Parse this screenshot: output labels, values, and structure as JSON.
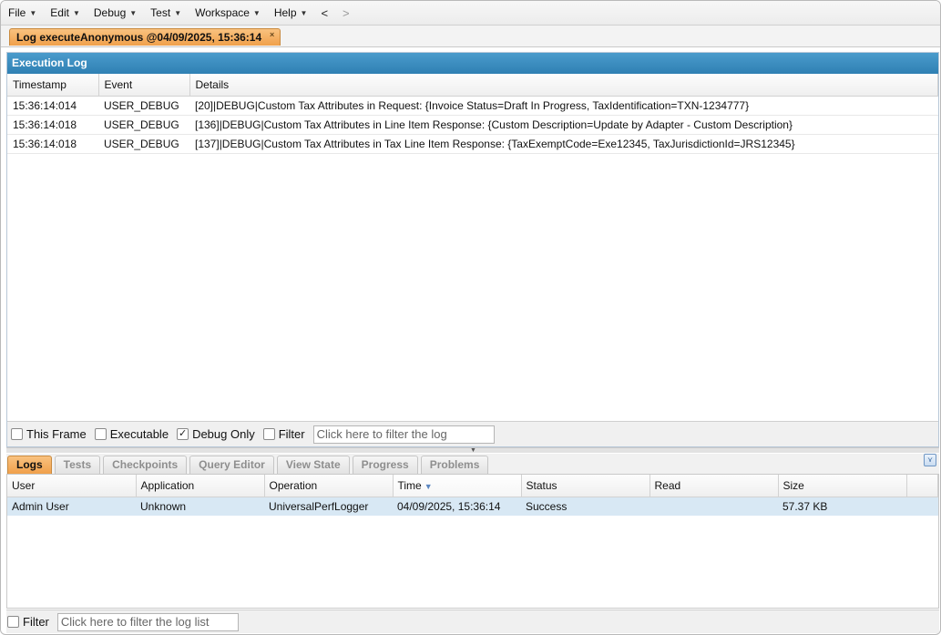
{
  "menubar": {
    "items": [
      {
        "label": "File"
      },
      {
        "label": "Edit"
      },
      {
        "label": "Debug"
      },
      {
        "label": "Test"
      },
      {
        "label": "Workspace"
      },
      {
        "label": "Help"
      }
    ],
    "back": "<",
    "forward": ">"
  },
  "doc_tab": {
    "label": "Log executeAnonymous @04/09/2025, 15:36:14",
    "close": "×"
  },
  "execution_log": {
    "title": "Execution Log",
    "columns": [
      "Timestamp",
      "Event",
      "Details"
    ],
    "rows": [
      {
        "timestamp": "15:36:14:014",
        "event": "USER_DEBUG",
        "details": "[20]|DEBUG|Custom Tax Attributes in Request: {Invoice Status=Draft In Progress, TaxIdentification=TXN-1234777}"
      },
      {
        "timestamp": "15:36:14:018",
        "event": "USER_DEBUG",
        "details": "[136]|DEBUG|Custom Tax Attributes in Line Item Response: {Custom Description=Update by Adapter - Custom Description}"
      },
      {
        "timestamp": "15:36:14:018",
        "event": "USER_DEBUG",
        "details": "[137]|DEBUG|Custom Tax Attributes in Tax Line Item Response: {TaxExemptCode=Exe12345, TaxJurisdictionId=JRS12345}"
      }
    ],
    "filters": {
      "this_frame": {
        "label": "This Frame",
        "checked": false
      },
      "executable": {
        "label": "Executable",
        "checked": false
      },
      "debug_only": {
        "label": "Debug Only",
        "checked": true
      },
      "filter": {
        "label": "Filter",
        "checked": false
      },
      "placeholder": "Click here to filter the log"
    }
  },
  "lower_tabs": [
    {
      "label": "Logs",
      "active": true
    },
    {
      "label": "Tests",
      "active": false
    },
    {
      "label": "Checkpoints",
      "active": false
    },
    {
      "label": "Query Editor",
      "active": false
    },
    {
      "label": "View State",
      "active": false
    },
    {
      "label": "Progress",
      "active": false
    },
    {
      "label": "Problems",
      "active": false
    }
  ],
  "log_list": {
    "columns": [
      "User",
      "Application",
      "Operation",
      "Time",
      "Status",
      "Read",
      "Size"
    ],
    "sorted_column": "Time",
    "rows": [
      {
        "user": "Admin User",
        "application": "Unknown",
        "operation": "UniversalPerfLogger",
        "time": "04/09/2025, 15:36:14",
        "status": "Success",
        "read": "",
        "size": "57.37 KB"
      }
    ],
    "filter": {
      "label": "Filter",
      "checked": false,
      "placeholder": "Click here to filter the log list"
    }
  },
  "colors": {
    "accent_orange": "#f0a04b",
    "title_blue": "#2f80b3",
    "selected_row": "#d8e8f4"
  }
}
